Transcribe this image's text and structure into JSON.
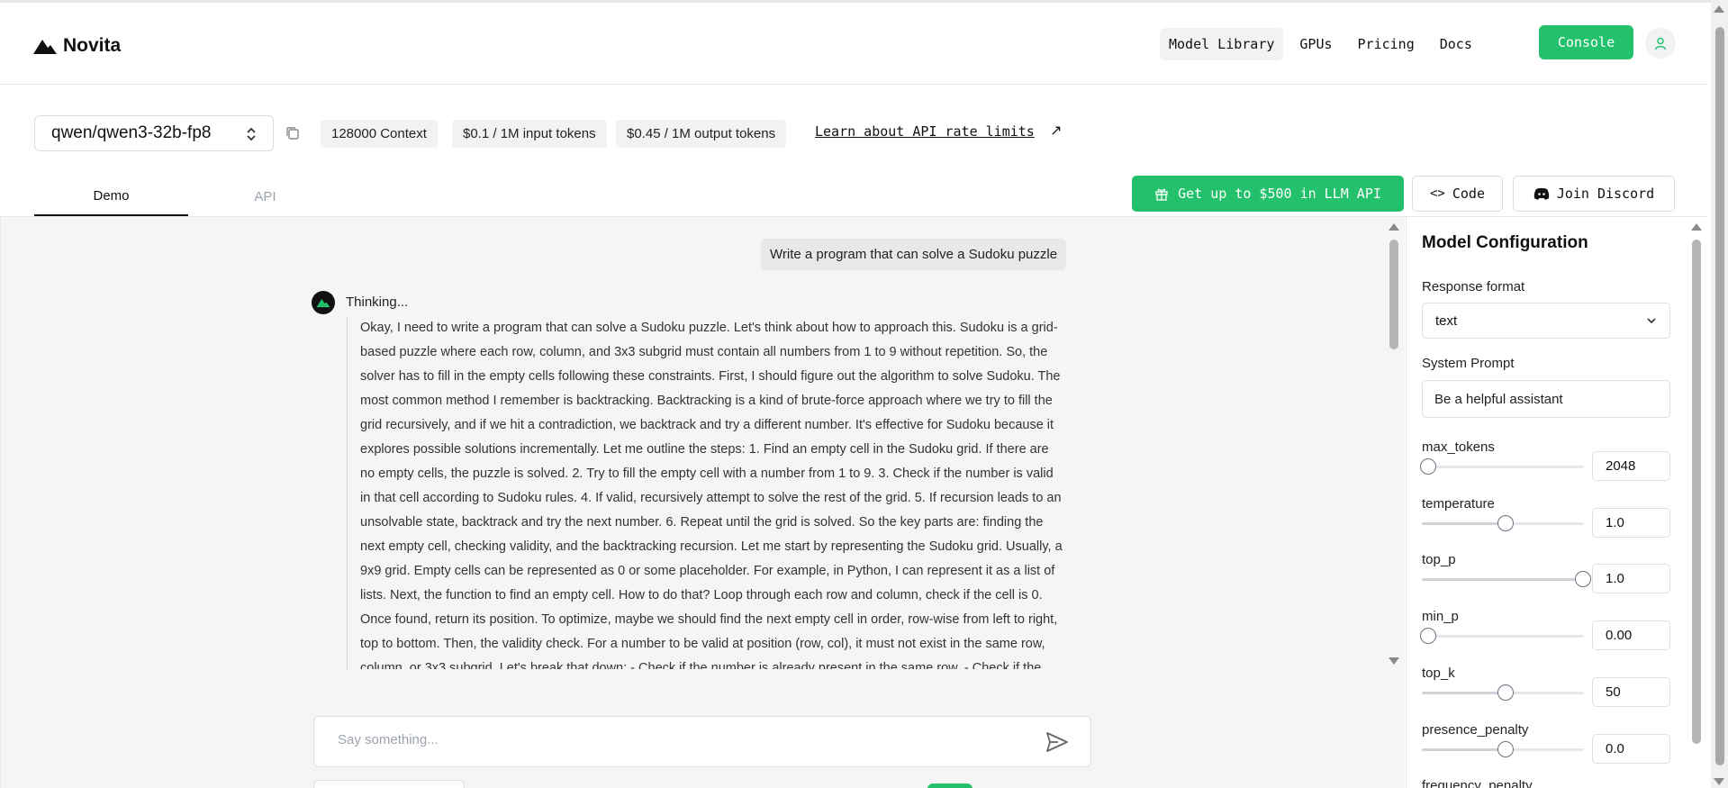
{
  "nav": {
    "brand": "Novita",
    "links": [
      "Model Library",
      "GPUs",
      "Pricing",
      "Docs"
    ],
    "console_label": "Console"
  },
  "model": {
    "name": "qwen/qwen3-32b-fp8",
    "chips": [
      "128000 Context",
      "$0.1 / 1M input tokens",
      "$0.45 / 1M output tokens"
    ],
    "rate_link": "Learn about API rate limits",
    "rate_arrow": "↗"
  },
  "tabs": [
    "Demo",
    "API"
  ],
  "actions": {
    "promo": "Get up to $500 in LLM API",
    "code": "Code",
    "discord": "Join Discord"
  },
  "chat": {
    "user_message": "Write a program that can solve a Sudoku puzzle",
    "thinking_label": "Thinking...",
    "thinking_text": "Okay, I need to write a program that can solve a Sudoku puzzle. Let's think about how to approach this. Sudoku is a grid-based puzzle where each row, column, and 3x3 subgrid must contain all numbers from 1 to 9 without repetition. So, the solver has to fill in the empty cells following these constraints. First, I should figure out the algorithm to solve Sudoku. The most common method I remember is backtracking. Backtracking is a kind of brute-force approach where we try to fill the grid recursively, and if we hit a contradiction, we backtrack and try a different number. It's effective for Sudoku because it explores possible solutions incrementally. Let me outline the steps: 1. Find an empty cell in the Sudoku grid. If there are no empty cells, the puzzle is solved. 2. Try to fill the empty cell with a number from 1 to 9. 3. Check if the number is valid in that cell according to Sudoku rules. 4. If valid, recursively attempt to solve the rest of the grid. 5. If recursion leads to an unsolvable state, backtrack and try the next number. 6. Repeat until the grid is solved. So the key parts are: finding the next empty cell, checking validity, and the backtracking recursion. Let me start by representing the Sudoku grid. Usually, a 9x9 grid. Empty cells can be represented as 0 or some placeholder. For example, in Python, I can represent it as a list of lists. Next, the function to find an empty cell. How to do that? Loop through each row and column, check if the cell is 0. Once found, return its position. To optimize, maybe we should find the next empty cell in order, row-wise from left to right, top to bottom. Then, the validity check. For a number to be valid at position (row, col), it must not exist in the same row, column, or 3x3 subgrid. Let's break that down: - Check if the number is already present in the same row. - Check if the number is",
    "input_placeholder": "Say something..."
  },
  "config": {
    "title": "Model Configuration",
    "response_format_label": "Response format",
    "response_format_value": "text",
    "system_prompt_label": "System Prompt",
    "system_prompt_value": "Be a helpful assistant",
    "params": [
      {
        "label": "max_tokens",
        "value": "2048",
        "fraction": 0.0
      },
      {
        "label": "temperature",
        "value": "1.0",
        "fraction": 0.5
      },
      {
        "label": "top_p",
        "value": "1.0",
        "fraction": 1.0
      },
      {
        "label": "min_p",
        "value": "0.00",
        "fraction": 0.0
      },
      {
        "label": "top_k",
        "value": "50",
        "fraction": 0.5
      },
      {
        "label": "presence_penalty",
        "value": "0.0",
        "fraction": 0.5
      },
      {
        "label": "frequency_penalty",
        "value": "",
        "fraction": 0.5
      }
    ]
  },
  "colors": {
    "brand_green": "#23c16b",
    "chat_bg": "#f5f5f5"
  }
}
